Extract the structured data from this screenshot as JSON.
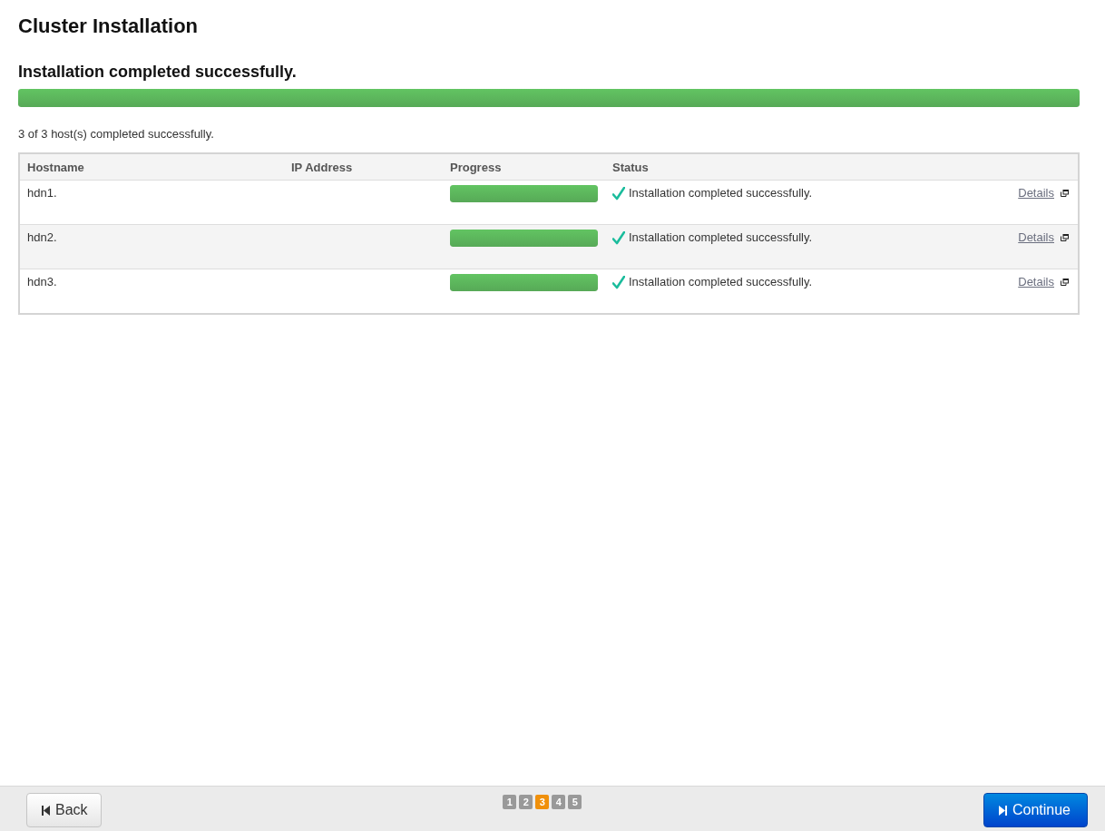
{
  "title": "Cluster Installation",
  "summary": {
    "heading": "Installation completed successfully.",
    "level": 1
  },
  "hosts_message": "3 of 3 host(s) completed successfully.",
  "table": {
    "columns": [
      "Hostname",
      "IP Address",
      "Progress",
      "Status"
    ],
    "rows": [
      {
        "hostname": "hdn1.",
        "ip": "",
        "level": 1,
        "status": "Installation completed successfully.",
        "success": true,
        "link": "Details"
      },
      {
        "hostname": "hdn2.",
        "ip": "",
        "level": 1,
        "status": "Installation completed successfully.",
        "success": true,
        "link": "Details"
      },
      {
        "hostname": "hdn3.",
        "ip": "",
        "level": 1,
        "status": "Installation completed successfully.",
        "success": true,
        "link": "Details"
      }
    ]
  },
  "footer": {
    "back": "Back",
    "continue": "Continue",
    "steps": [
      {
        "label": "1",
        "selected": false
      },
      {
        "label": "2",
        "selected": false
      },
      {
        "label": "3",
        "selected": true
      },
      {
        "label": "4",
        "selected": false
      },
      {
        "label": "5",
        "selected": false
      }
    ]
  }
}
